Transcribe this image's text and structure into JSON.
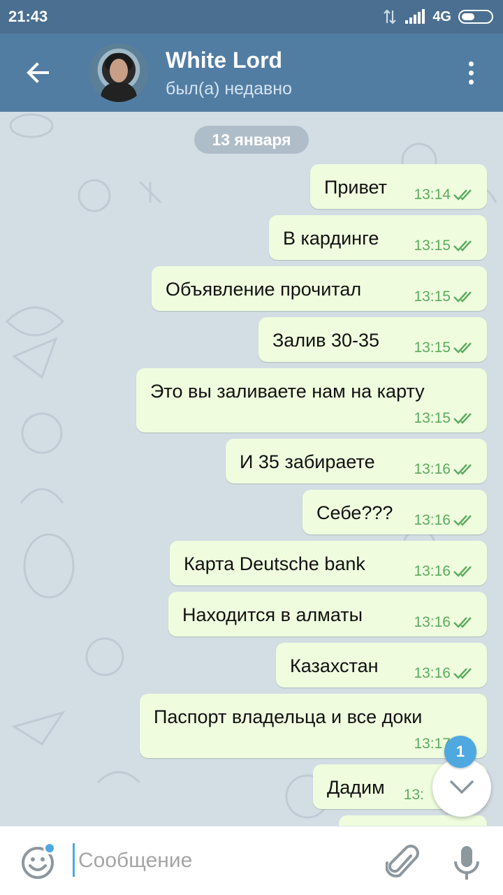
{
  "status_bar": {
    "time": "21:43",
    "network": "4G"
  },
  "header": {
    "title": "White Lord",
    "subtitle": "был(а) недавно"
  },
  "chat": {
    "date": "13 января",
    "messages": [
      {
        "text": "Привет",
        "time": "13:14"
      },
      {
        "text": "В кардинге",
        "time": "13:15"
      },
      {
        "text": "Объявление прочитал",
        "time": "13:15"
      },
      {
        "text": "Залив 30-35",
        "time": "13:15"
      },
      {
        "text": "Это вы заливаете нам на карту",
        "time": "13:15"
      },
      {
        "text": "И 35 забираете",
        "time": "13:16"
      },
      {
        "text": "Себе???",
        "time": "13:16"
      },
      {
        "text": "Карта Deutsche bank",
        "time": "13:16"
      },
      {
        "text": "Находится в алматы",
        "time": "13:16"
      },
      {
        "text": "Казахстан",
        "time": "13:16"
      },
      {
        "text": "Паспорт владельца и все доки",
        "time": "13:17"
      },
      {
        "text": "Дадим",
        "time": "13:"
      }
    ],
    "unread_badge": "1"
  },
  "composer": {
    "placeholder": "Сообщение"
  },
  "colors": {
    "header": "#527da3",
    "status_bar": "#4a6f90",
    "bubble": "#effdde",
    "time": "#5bab5f",
    "accent": "#4fa8e0"
  },
  "icons": [
    "back-arrow-icon",
    "more-vert-icon",
    "double-check-icon",
    "chevron-down-icon",
    "emoji-icon",
    "attach-icon",
    "mic-icon"
  ]
}
